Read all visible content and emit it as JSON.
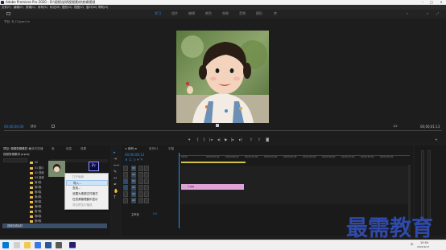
{
  "titlebar": {
    "title": "Adobe Premiere Pro 2020 - D:\\视频\\说明视频素材\\剪辑视频"
  },
  "menu": [
    "文件(F)",
    "编辑(E)",
    "剪辑(C)",
    "序列(S)",
    "标记(M)",
    "图形(G)",
    "视图(V)",
    "窗口(W)",
    "帮助(H)"
  ],
  "workspaces": [
    {
      "label": "学习",
      "active": true
    },
    {
      "label": "组件",
      "active": false
    },
    {
      "label": "编辑",
      "active": false
    },
    {
      "label": "颜色",
      "active": false
    },
    {
      "label": "效果",
      "active": false
    },
    {
      "label": "音频",
      "active": false
    },
    {
      "label": "图形",
      "active": false
    },
    {
      "label": "库",
      "active": false
    }
  ],
  "source_panel": {
    "title": "节目: 无 (1)/yan) ≡"
  },
  "program": {
    "timecode_left": "00;00;00;00",
    "fit": "适合",
    "fraction": "1/2",
    "timecode_right": "00;00;01;13"
  },
  "project_panel": {
    "tabs": [
      "项目: 视频剪辑素材 ≡",
      "媒体浏览器",
      "库",
      "信息",
      "效果"
    ],
    "bin_label": "视频剪辑素材.prproj",
    "items": [
      "00",
      "01 图片",
      "02 视频",
      "03 音频",
      "第1集",
      "第2集",
      "第3集",
      "第4集",
      "第5集",
      "第6集",
      "第7集",
      "第8集",
      "第9集",
      "第10集",
      "项目.psd"
    ],
    "selected_item": "视频剪辑素材"
  },
  "context_menu": {
    "items": [
      {
        "label": "打开面板",
        "disabled": true
      },
      {
        "label": "导入...",
        "highlighted": true
      },
      {
        "label": "查找...",
        "disabled": false
      },
      {
        "label": "设置为视频文件格式",
        "disabled": false
      },
      {
        "label": "在资源管理器中显示",
        "disabled": false
      },
      {
        "label": "项目预览中播放",
        "disabled": true
      }
    ]
  },
  "timeline": {
    "tabs": [
      "× 序列 ≡",
      "序列01",
      "字幕"
    ],
    "timecode": "00;00;06;12",
    "ruler": [
      "00;00",
      "00;00;04;00",
      "00;00;08;00",
      "00;00;12;00",
      "00;00;16;00",
      "00;00;20;00",
      "00;00;24;00",
      "00;00;28;00",
      "00;00;32;00",
      "00;00;36;00",
      "00;00;40;00",
      "00;00;44;00"
    ],
    "tracks": [
      "V3",
      "V2",
      "V1",
      "A1",
      "A2",
      "A3"
    ],
    "master": "主声道",
    "master_value": "0.0",
    "clip_label": "1.jpg"
  },
  "watermark": "最需教育",
  "taskbar": {
    "time": "10:54",
    "date": "2021/9/17",
    "lang": "中"
  }
}
